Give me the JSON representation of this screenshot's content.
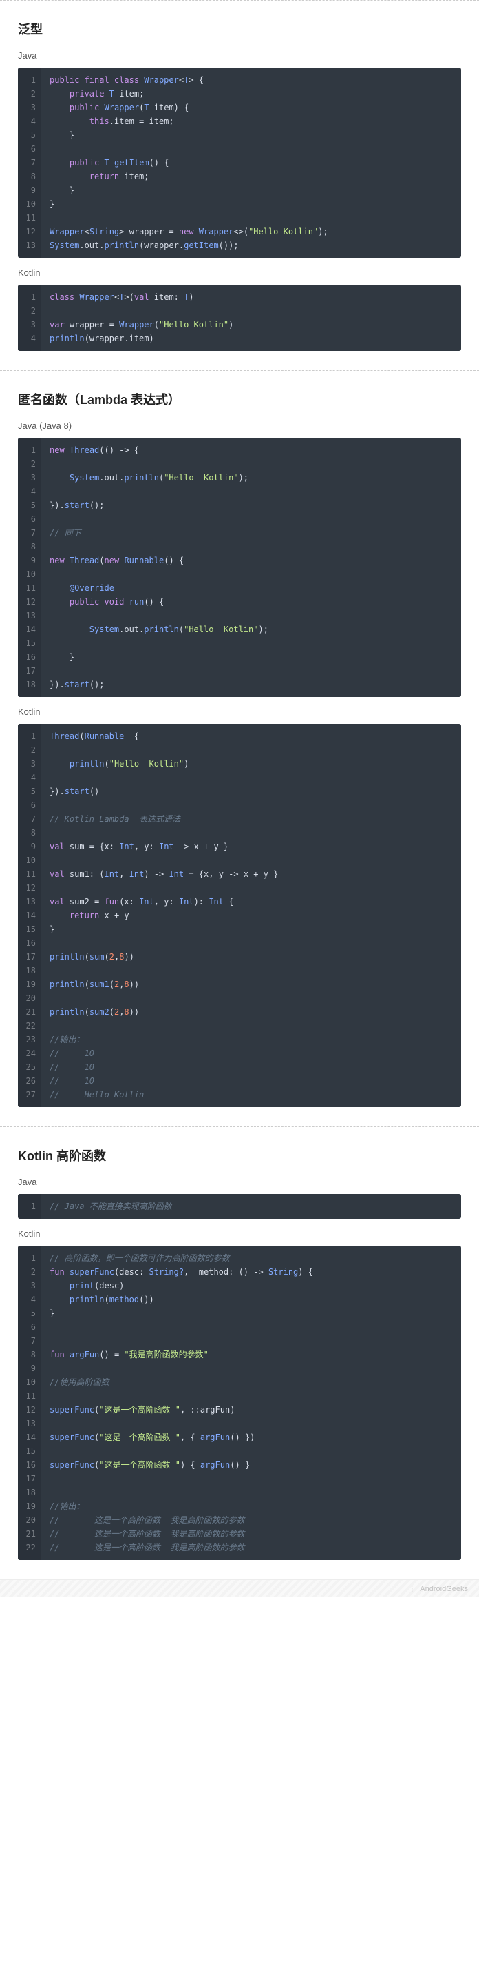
{
  "sections": [
    {
      "title": "泛型",
      "blocks": [
        {
          "label": "Java",
          "lines": [
            {
              "n": 1,
              "html": "<span class='kw'>public final class</span> <span class='type'>Wrapper</span>&lt;<span class='type'>T</span>&gt; {"
            },
            {
              "n": 2,
              "html": "    <span class='kw'>private</span> <span class='type'>T</span> item;"
            },
            {
              "n": 3,
              "html": "    <span class='kw'>public</span> <span class='type'>Wrapper</span>(<span class='type'>T</span> item) {"
            },
            {
              "n": 4,
              "html": "        <span class='kw2'>this</span>.item = item;"
            },
            {
              "n": 5,
              "html": "    }"
            },
            {
              "n": 6,
              "html": ""
            },
            {
              "n": 7,
              "html": "    <span class='kw'>public</span> <span class='type'>T</span> <span class='fn'>getItem</span>() {"
            },
            {
              "n": 8,
              "html": "        <span class='kw2'>return</span> item;"
            },
            {
              "n": 9,
              "html": "    }"
            },
            {
              "n": 10,
              "html": "}"
            },
            {
              "n": 11,
              "html": ""
            },
            {
              "n": 12,
              "html": "<span class='type'>Wrapper</span>&lt;<span class='type'>String</span>&gt; wrapper = <span class='kw2'>new</span> <span class='type'>Wrapper</span>&lt;&gt;(<span class='str'>\"Hello Kotlin\"</span>);"
            },
            {
              "n": 13,
              "html": "<span class='type'>System</span>.out.<span class='fn'>println</span>(wrapper.<span class='fn'>getItem</span>());"
            }
          ]
        },
        {
          "label": "Kotlin",
          "lines": [
            {
              "n": 1,
              "html": "<span class='kw'>class</span> <span class='type'>Wrapper</span>&lt;<span class='type'>T</span>&gt;(<span class='kw'>val</span> item: <span class='type'>T</span>)"
            },
            {
              "n": 2,
              "html": ""
            },
            {
              "n": 3,
              "html": "<span class='kw'>var</span> wrapper = <span class='type'>Wrapper</span>(<span class='str'>\"Hello Kotlin\"</span>)"
            },
            {
              "n": 4,
              "html": "<span class='fn'>println</span>(wrapper.item)"
            }
          ]
        }
      ]
    },
    {
      "title": "匿名函数（Lambda 表达式）",
      "blocks": [
        {
          "label": "Java (Java 8)",
          "lines": [
            {
              "n": 1,
              "html": "<span class='kw2'>new</span> <span class='type'>Thread</span>(() -&gt; {"
            },
            {
              "n": 2,
              "html": ""
            },
            {
              "n": 3,
              "html": "    <span class='type'>System</span>.out.<span class='fn'>println</span>(<span class='str'>\"Hello  Kotlin\"</span>);"
            },
            {
              "n": 4,
              "html": ""
            },
            {
              "n": 5,
              "html": "}).<span class='fn'>start</span>();"
            },
            {
              "n": 6,
              "html": ""
            },
            {
              "n": 7,
              "html": "<span class='com'>// 同下</span>"
            },
            {
              "n": 8,
              "html": ""
            },
            {
              "n": 9,
              "html": "<span class='kw2'>new</span> <span class='type'>Thread</span>(<span class='kw2'>new</span> <span class='type'>Runnable</span>() {"
            },
            {
              "n": 10,
              "html": ""
            },
            {
              "n": 11,
              "html": "    <span class='type'>@Override</span>"
            },
            {
              "n": 12,
              "html": "    <span class='kw'>public void</span> <span class='fn'>run</span>() {"
            },
            {
              "n": 13,
              "html": ""
            },
            {
              "n": 14,
              "html": "        <span class='type'>System</span>.out.<span class='fn'>println</span>(<span class='str'>\"Hello  Kotlin\"</span>);"
            },
            {
              "n": 15,
              "html": ""
            },
            {
              "n": 16,
              "html": "    }"
            },
            {
              "n": 17,
              "html": ""
            },
            {
              "n": 18,
              "html": "}).<span class='fn'>start</span>();"
            }
          ]
        },
        {
          "label": "Kotlin",
          "lines": [
            {
              "n": 1,
              "html": "<span class='type'>Thread</span>(<span class='type'>Runnable</span>  {"
            },
            {
              "n": 2,
              "html": ""
            },
            {
              "n": 3,
              "html": "    <span class='fn'>println</span>(<span class='str'>\"Hello  Kotlin\"</span>)"
            },
            {
              "n": 4,
              "html": ""
            },
            {
              "n": 5,
              "html": "}).<span class='fn'>start</span>()"
            },
            {
              "n": 6,
              "html": ""
            },
            {
              "n": 7,
              "html": "<span class='com'>// Kotlin Lambda  表达式语法</span>"
            },
            {
              "n": 8,
              "html": ""
            },
            {
              "n": 9,
              "html": "<span class='kw'>val</span> sum = {x: <span class='type'>Int</span>, y: <span class='type'>Int</span> -&gt; x + y }"
            },
            {
              "n": 10,
              "html": ""
            },
            {
              "n": 11,
              "html": "<span class='kw'>val</span> sum1: (<span class='type'>Int</span>, <span class='type'>Int</span>) -&gt; <span class='type'>Int</span> = {x, y -&gt; x + y }"
            },
            {
              "n": 12,
              "html": ""
            },
            {
              "n": 13,
              "html": "<span class='kw'>val</span> sum2 = <span class='kw'>fun</span>(x: <span class='type'>Int</span>, y: <span class='type'>Int</span>): <span class='type'>Int</span> {"
            },
            {
              "n": 14,
              "html": "    <span class='kw2'>return</span> x + y"
            },
            {
              "n": 15,
              "html": "}"
            },
            {
              "n": 16,
              "html": ""
            },
            {
              "n": 17,
              "html": "<span class='fn'>println</span>(<span class='fn'>sum</span>(<span class='num'>2</span>,<span class='num'>8</span>))"
            },
            {
              "n": 18,
              "html": ""
            },
            {
              "n": 19,
              "html": "<span class='fn'>println</span>(<span class='fn'>sum1</span>(<span class='num'>2</span>,<span class='num'>8</span>))"
            },
            {
              "n": 20,
              "html": ""
            },
            {
              "n": 21,
              "html": "<span class='fn'>println</span>(<span class='fn'>sum2</span>(<span class='num'>2</span>,<span class='num'>8</span>))"
            },
            {
              "n": 22,
              "html": ""
            },
            {
              "n": 23,
              "html": "<span class='com'>//输出：</span>"
            },
            {
              "n": 24,
              "html": "<span class='com'>//     10</span>"
            },
            {
              "n": 25,
              "html": "<span class='com'>//     10</span>"
            },
            {
              "n": 26,
              "html": "<span class='com'>//     10</span>"
            },
            {
              "n": 27,
              "html": "<span class='com'>//     Hello Kotlin</span>"
            }
          ]
        }
      ]
    },
    {
      "title": "Kotlin 高阶函数",
      "blocks": [
        {
          "label": "Java",
          "lines": [
            {
              "n": 1,
              "html": "<span class='com'>// Java 不能直接实现高阶函数</span>"
            }
          ]
        },
        {
          "label": "Kotlin",
          "lines": [
            {
              "n": 1,
              "html": "<span class='com'>// 高阶函数，即一个函数可作为高阶函数的参数</span>"
            },
            {
              "n": 2,
              "html": "<span class='kw'>fun</span> <span class='fn'>superFunc</span>(desc: <span class='type'>String?</span>,  method: () -&gt; <span class='type'>String</span>) {"
            },
            {
              "n": 3,
              "html": "    <span class='fn'>print</span>(desc)"
            },
            {
              "n": 4,
              "html": "    <span class='fn'>println</span>(<span class='fn'>method</span>())"
            },
            {
              "n": 5,
              "html": "}"
            },
            {
              "n": 6,
              "html": ""
            },
            {
              "n": 7,
              "html": ""
            },
            {
              "n": 8,
              "html": "<span class='kw'>fun</span> <span class='fn'>argFun</span>() = <span class='str'>\"我是高阶函数的参数\"</span>"
            },
            {
              "n": 9,
              "html": ""
            },
            {
              "n": 10,
              "html": "<span class='com'>//使用高阶函数</span>"
            },
            {
              "n": 11,
              "html": ""
            },
            {
              "n": 12,
              "html": "<span class='fn'>superFunc</span>(<span class='str'>\"这是一个高阶函数 \"</span>, ::argFun)"
            },
            {
              "n": 13,
              "html": ""
            },
            {
              "n": 14,
              "html": "<span class='fn'>superFunc</span>(<span class='str'>\"这是一个高阶函数 \"</span>, { <span class='fn'>argFun</span>() })"
            },
            {
              "n": 15,
              "html": ""
            },
            {
              "n": 16,
              "html": "<span class='fn'>superFunc</span>(<span class='str'>\"这是一个高阶函数 \"</span>) { <span class='fn'>argFun</span>() }"
            },
            {
              "n": 17,
              "html": ""
            },
            {
              "n": 18,
              "html": ""
            },
            {
              "n": 19,
              "html": "<span class='com'>//输出：</span>"
            },
            {
              "n": 20,
              "html": "<span class='com'>//       这是一个高阶函数  我是高阶函数的参数</span>"
            },
            {
              "n": 21,
              "html": "<span class='com'>//       这是一个高阶函数  我是高阶函数的参数</span>"
            },
            {
              "n": 22,
              "html": "<span class='com'>//       这是一个高阶函数  我是高阶函数的参数</span>"
            }
          ]
        }
      ]
    }
  ],
  "footer": "AndroidGeeks"
}
